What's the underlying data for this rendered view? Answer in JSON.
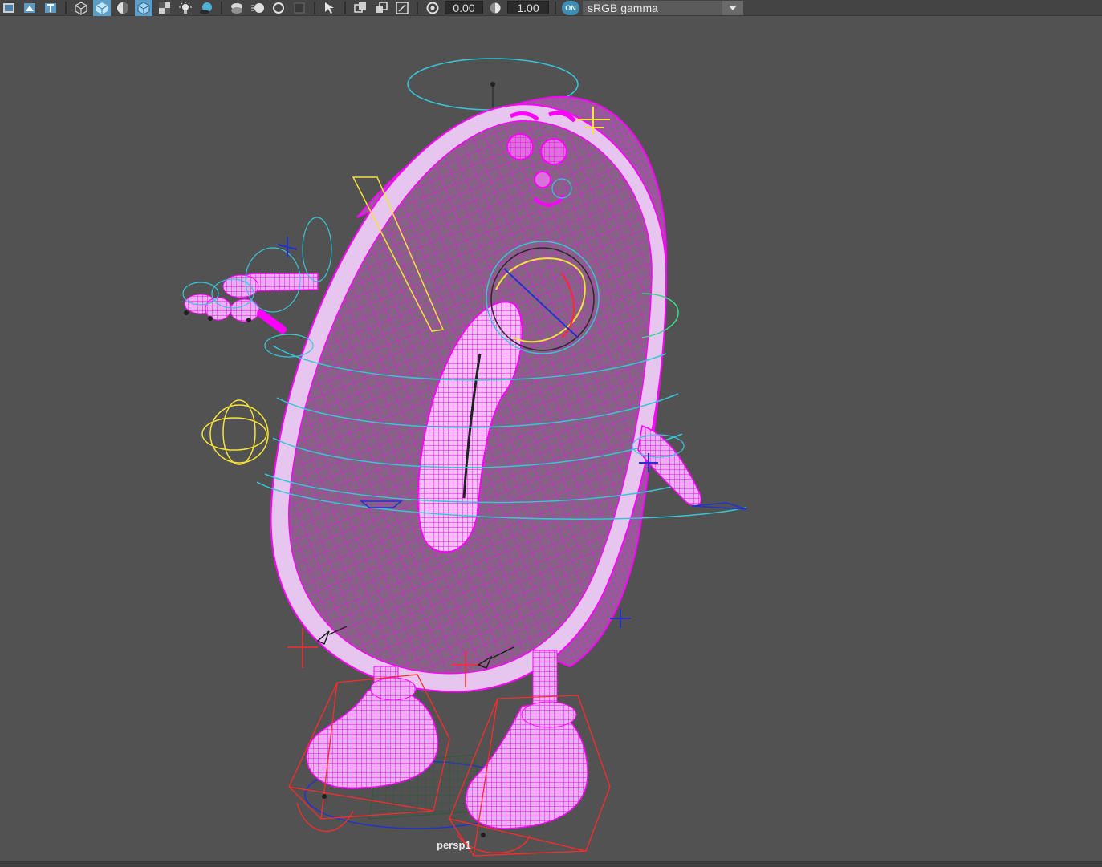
{
  "toolbar": {
    "exposure_value": "0.00",
    "gamma_value": "1.00",
    "color_mgmt_badge": "ON",
    "view_transform": "sRGB gamma",
    "icons": [
      "image-plane-icon",
      "grid-icon",
      "text-icon",
      "wireframe-cube-icon",
      "smooth-shade-icon",
      "texture-icon",
      "wireframe-on-shaded-icon",
      "xray-icon",
      "lights-icon",
      "shadows-icon",
      "ambient-occlusion-icon",
      "motion-blur-icon",
      "anti-alias-icon",
      "depth-of-field-icon",
      "isolate-select-icon",
      "xray-joints-icon",
      "xray-active-icon",
      "backface-icon",
      "exposure-icon",
      "gamma-icon",
      "color-management-icon"
    ]
  },
  "viewport": {
    "camera_label": "persp1",
    "background_color": "#525252",
    "wireframe_color": "#ff00ff",
    "shaded_color": "#8a5c8a"
  }
}
